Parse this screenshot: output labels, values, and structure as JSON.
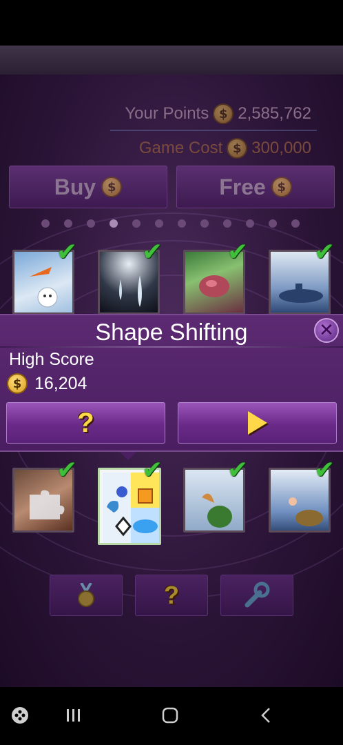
{
  "points": {
    "your_points_label": "Your Points",
    "your_points_value": "2,585,762",
    "game_cost_label": "Game Cost",
    "game_cost_value": "300,000",
    "coin_symbol": "$"
  },
  "buttons": {
    "buy_label": "Buy",
    "free_label": "Free"
  },
  "pager": {
    "total": 12,
    "active_index": 3
  },
  "selected_game": {
    "title": "Shape Shifting",
    "high_score_label": "High Score",
    "high_score_value": "16,204",
    "help_glyph": "?",
    "close_glyph": "✕"
  },
  "toolbar": {
    "help_glyph": "?"
  },
  "colors": {
    "panel_purple": "#5c2a72",
    "check_green": "#3fbf3a",
    "coin_gold": "#f0c960",
    "accent_yellow": "#ffd84a"
  },
  "icons": [
    "coin-icon",
    "check-icon",
    "close-icon",
    "question-icon",
    "play-icon",
    "medal-icon",
    "wrench-icon",
    "back-icon",
    "home-icon",
    "recents-icon",
    "gamepad-icon"
  ]
}
